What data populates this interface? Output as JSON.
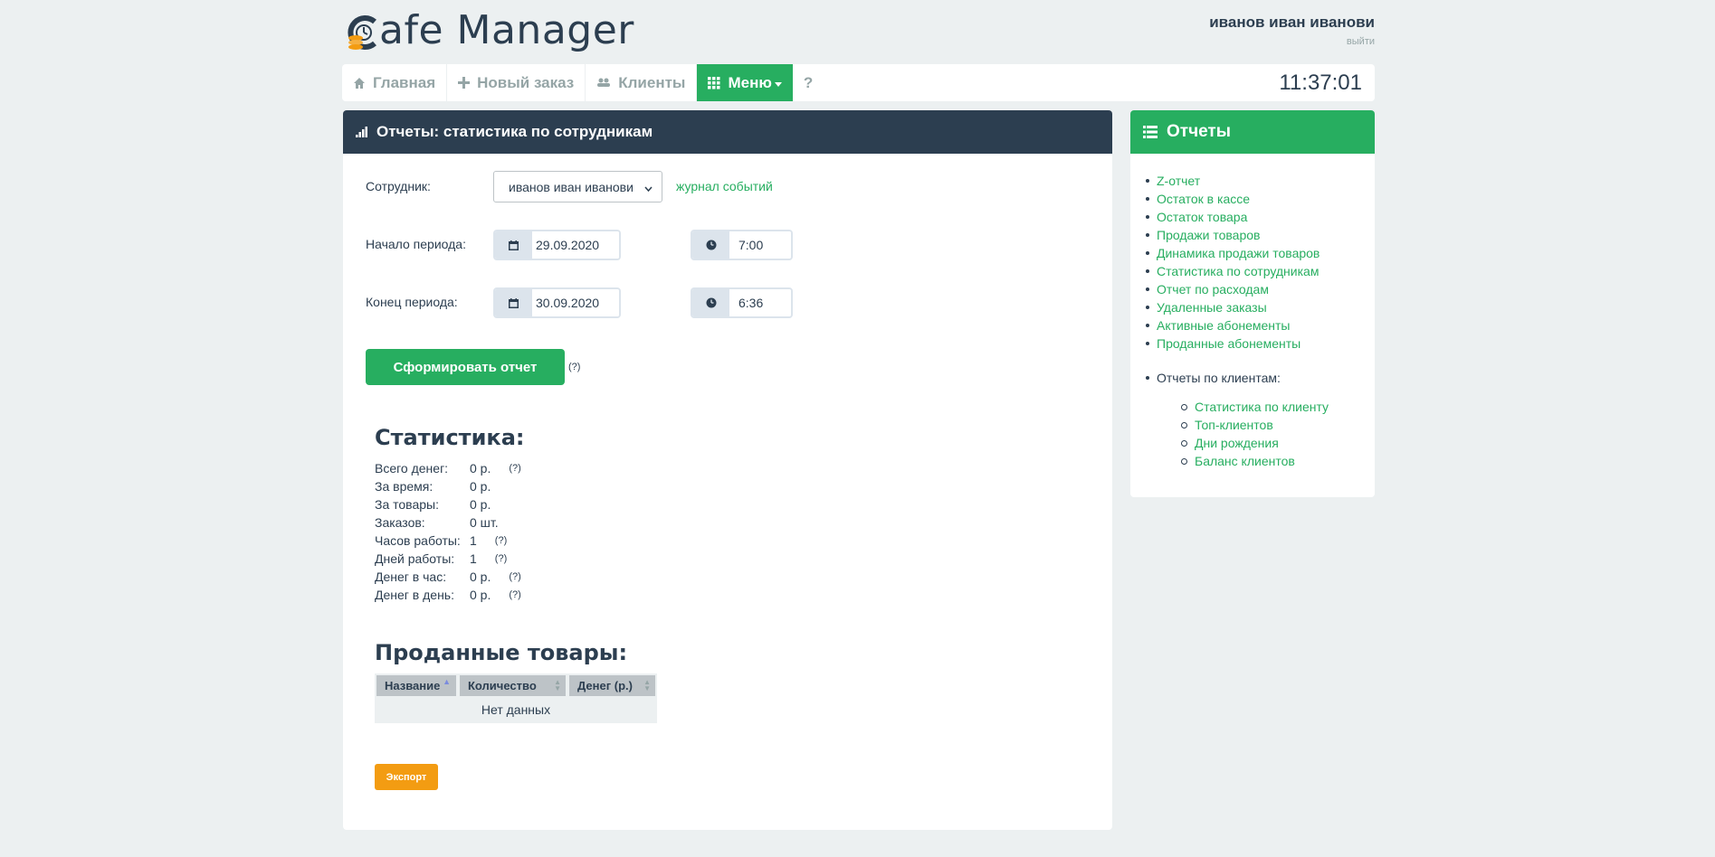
{
  "brand": {
    "logo_text": "afe Manager"
  },
  "header": {
    "user_name": "иванов иван иванови",
    "logout": "выйти"
  },
  "navbar": {
    "items": [
      {
        "label": "Главная",
        "icon": "home-icon"
      },
      {
        "label": "Новый заказ",
        "icon": "plus-icon"
      },
      {
        "label": "Клиенты",
        "icon": "users-icon"
      },
      {
        "label": "Меню",
        "icon": "grid-icon",
        "active": true
      },
      {
        "label": "?"
      }
    ],
    "clock": "11:37:01"
  },
  "main": {
    "title": "Отчеты: статистика по сотрудникам",
    "employee_label": "Сотрудник:",
    "employee_value": "иванов иван иванови",
    "events_link": "журнал событий",
    "start_label": "Начало периода:",
    "start_date": "29.09.2020",
    "start_time": "7:00",
    "end_label": "Конец периода:",
    "end_date": "30.09.2020",
    "end_time": "6:36",
    "generate_button": "Сформировать отчет",
    "generate_hint": "(?)",
    "stats_title": "Статистика:",
    "stats": [
      {
        "label": "Всего денег:",
        "value": "0 р.",
        "hint": "(?)"
      },
      {
        "label": "За время:",
        "value": "0 р.",
        "hint": ""
      },
      {
        "label": "За товары:",
        "value": "0 р.",
        "hint": ""
      },
      {
        "label": "Заказов:",
        "value": "0 шт.",
        "hint": ""
      },
      {
        "label": "Часов работы:",
        "value": "1",
        "hint": "(?)"
      },
      {
        "label": "Дней работы:",
        "value": "1",
        "hint": "(?)"
      },
      {
        "label": "Денег в час:",
        "value": "0 р.",
        "hint": "(?)"
      },
      {
        "label": "Денег в день:",
        "value": "0 р.",
        "hint": "(?)"
      }
    ],
    "sold_title": "Проданные товары:",
    "table": {
      "columns": [
        "Название",
        "Количество",
        "Денег (р.)"
      ],
      "empty": "Нет данных"
    },
    "export_button": "Экспорт"
  },
  "side": {
    "title": "Отчеты",
    "links": [
      "Z-отчет",
      "Остаток в кассе",
      "Остаток товара",
      "Продажи товаров",
      "Динамика продажи товаров",
      "Статистика по сотрудникам",
      "Отчет по расходам",
      "Удаленные заказы",
      "Активные абонементы",
      "Проданные абонементы"
    ],
    "clients_title": "Отчеты по клиентам:",
    "client_links": [
      "Статистика по клиенту",
      "Топ-клиентов",
      "Дни рождения",
      "Баланс клиентов"
    ]
  },
  "colors": {
    "primary": "#2c3e50",
    "accent": "#27ae60",
    "warning": "#f39c12",
    "muted": "#95a5a6",
    "background": "#ecf0f1"
  }
}
